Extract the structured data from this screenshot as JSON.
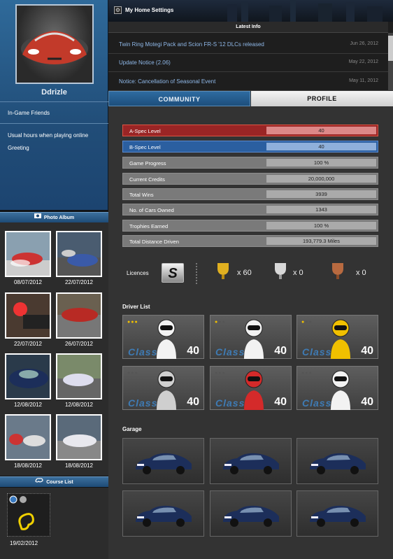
{
  "profile": {
    "username": "Ddrizle",
    "fields": [
      "In-Game Friends",
      "Usual hours when playing online",
      "Greeting"
    ]
  },
  "photo_album": {
    "title": "Photo Album",
    "icon": "camera-icon",
    "photos": [
      "08/07/2012",
      "22/07/2012",
      "22/07/2012",
      "26/07/2012",
      "12/08/2012",
      "12/08/2012",
      "18/08/2012",
      "18/08/2012"
    ]
  },
  "course_list": {
    "title": "Course List",
    "icon": "track-icon",
    "date": "19/02/2012"
  },
  "header": {
    "title": "My Home Settings",
    "icon": "gear-icon"
  },
  "latest_info": {
    "title": "Latest Info",
    "items": [
      {
        "text": "Twin Ring Motegi Pack and Scion FR-S '12 DLCs released",
        "date": "Jun 26, 2012"
      },
      {
        "text": "Update Notice (2.06)",
        "date": "May 22, 2012"
      },
      {
        "text": "Notice: Cancellation of Seasonal Event",
        "date": "May 11, 2012"
      }
    ]
  },
  "tabs": {
    "community": "COMMUNITY",
    "profile": "PROFILE"
  },
  "stats": [
    {
      "label": "A-Spec Level",
      "value": "40"
    },
    {
      "label": "B-Spec Level",
      "value": "40"
    },
    {
      "label": "Game Progress",
      "value": "100 %"
    },
    {
      "label": "Current Credits",
      "value": "20,000,000"
    },
    {
      "label": "Total Wins",
      "value": "3939"
    },
    {
      "label": "No. of Cars Owned",
      "value": "1343"
    },
    {
      "label": "Trophies Earned",
      "value": "100 %"
    },
    {
      "label": "Total Distance Driven",
      "value": "193,779.3 Miles"
    }
  ],
  "licences": {
    "label": "Licences",
    "badge": "S",
    "gold": "x 60",
    "silver": "x 0",
    "bronze": "x 0"
  },
  "drivers": {
    "title": "Driver List",
    "items": [
      {
        "class": "Class",
        "level": "40",
        "stars": 3,
        "suit": "#f2f2f2"
      },
      {
        "class": "Class",
        "level": "40",
        "stars": 1,
        "suit": "#f2f2f2"
      },
      {
        "class": "Class",
        "level": "40",
        "stars": 1,
        "suit": "#f0c000"
      },
      {
        "class": "Class",
        "level": "40",
        "stars": 0,
        "suit": "#cfcfcf"
      },
      {
        "class": "Class",
        "level": "40",
        "stars": 0,
        "suit": "#d42a2a"
      },
      {
        "class": "Class",
        "level": "40",
        "stars": 0,
        "suit": "#f2f2f2"
      }
    ]
  },
  "garage": {
    "title": "Garage",
    "count": 6,
    "car_color": "#1c2e5a"
  },
  "colors": {
    "accent": "#214d78",
    "a_spec": "#9a2525",
    "b_spec": "#2b5fa0"
  }
}
